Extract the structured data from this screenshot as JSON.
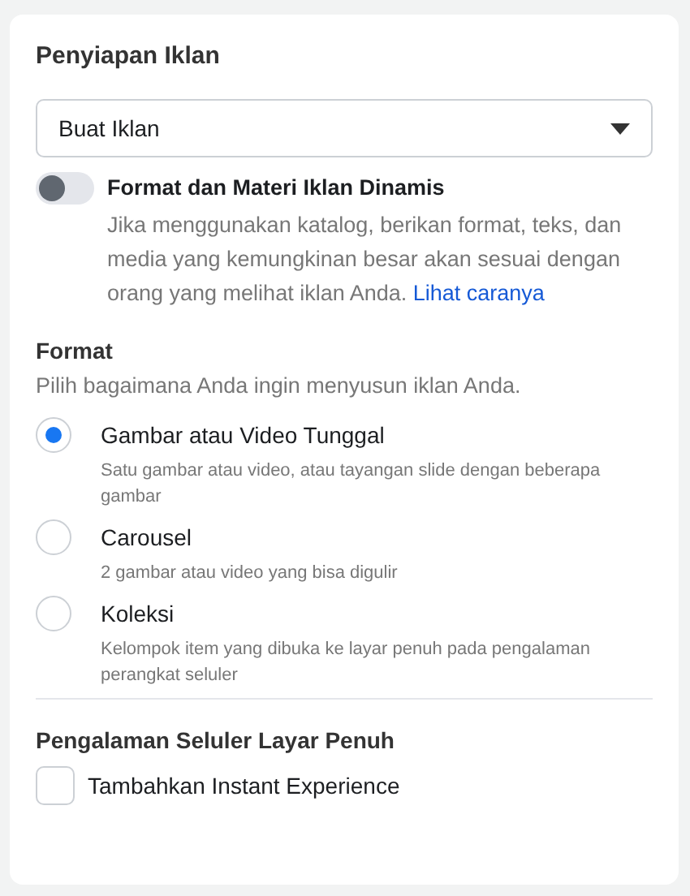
{
  "title": "Penyiapan Iklan",
  "dropdown": {
    "value": "Buat Iklan"
  },
  "dynamic_toggle": {
    "label": "Format dan Materi Iklan Dinamis",
    "on": false,
    "description": "Jika menggunakan katalog, berikan format, teks, dan media yang kemungkinan besar akan sesuai dengan orang yang melihat iklan Anda.",
    "link": "Lihat caranya"
  },
  "format": {
    "heading": "Format",
    "subtitle": "Pilih bagaimana Anda ingin menyusun iklan Anda.",
    "options": [
      {
        "label": "Gambar atau Video Tunggal",
        "description": "Satu gambar atau video, atau tayangan slide dengan beberapa gambar",
        "selected": true
      },
      {
        "label": "Carousel",
        "description": "2 gambar atau video yang bisa digulir",
        "selected": false
      },
      {
        "label": "Koleksi",
        "description": "Kelompok item yang dibuka ke layar penuh pada pengalaman perangkat seluler",
        "selected": false
      }
    ]
  },
  "fullscreen": {
    "heading": "Pengalaman Seluler Layar Penuh",
    "checkbox": {
      "label": "Tambahkan Instant Experience",
      "checked": false
    }
  }
}
